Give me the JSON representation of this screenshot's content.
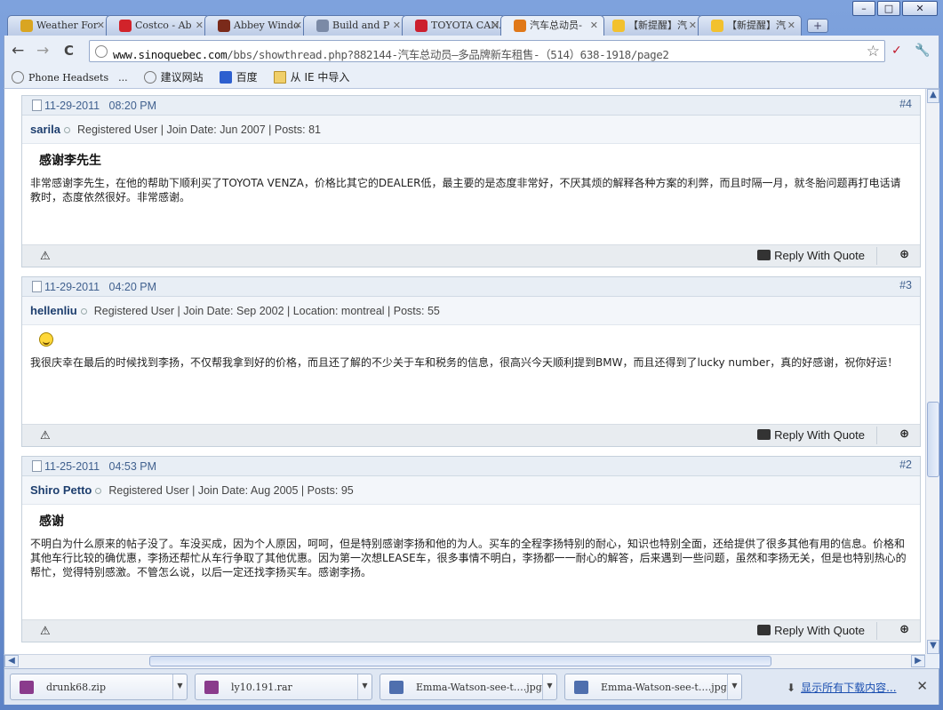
{
  "window": {
    "min": "–",
    "max": "□",
    "close": "✕"
  },
  "tabs": [
    {
      "label": "Weather For",
      "color": "#d9a521",
      "active": false
    },
    {
      "label": "Costco - Ab",
      "color": "#d1232a",
      "active": false
    },
    {
      "label": "Abbey Windo",
      "color": "#7a2a1a",
      "active": false
    },
    {
      "label": "Build and P",
      "color": "#7b8aa6",
      "active": false
    },
    {
      "label": "TOYOTA CANA",
      "color": "#cc1f2e",
      "active": false
    },
    {
      "label": "汽车总动员-",
      "color": "#e07818",
      "active": true
    },
    {
      "label": "【新提醒】汽",
      "color": "#f2c12e",
      "active": false
    },
    {
      "label": "【新提醒】汽",
      "color": "#f2c12e",
      "active": false
    }
  ],
  "toolbar": {
    "back": "←",
    "forward": "→",
    "reload": "C",
    "url_host": "www.sinoquebec.com",
    "url_path": "/bbs/showthread.php?882144-汽车总动员—多品牌新车租售-（514）638-1918/page2",
    "star": "☆",
    "wrench": "🔧"
  },
  "bookmarks": [
    {
      "label": "Phone Headsets　...",
      "mono": true
    },
    {
      "label": "建议网站",
      "mono": false
    },
    {
      "label": "百度",
      "mono": false
    },
    {
      "label": "从 IE 中导入",
      "mono": false
    }
  ],
  "posts": [
    {
      "date": "11-29-2011",
      "time": "08:20 PM",
      "number": "#4",
      "username": "sarila",
      "meta": "Registered User | Join Date: Jun 2007 | Posts: 81",
      "title": "感谢李先生",
      "body": "非常感谢李先生，在他的帮助下顺利买了TOYOTA VENZA，价格比其它的DEALER低，最主要的是态度非常好，不厌其烦的解释各种方案的利弊，而且时隔一月，就冬胎问题再打电话请教时，态度依然很好。非常感谢。"
    },
    {
      "date": "11-29-2011",
      "time": "04:20 PM",
      "number": "#3",
      "username": "hellenliu",
      "meta": "Registered User | Join Date: Sep 2002 | Location: montreal | Posts: 55",
      "title": "",
      "body": "我很庆幸在最后的时候找到李扬，不仅帮我拿到好的价格，而且还了解的不少关于车和税务的信息，很高兴今天顺利提到BMW，而且还得到了lucky number，真的好感谢，祝你好运！"
    },
    {
      "date": "11-25-2011",
      "time": "04:53 PM",
      "number": "#2",
      "username": "Shiro Petto",
      "meta": "Registered User | Join Date: Aug 2005 | Posts: 95",
      "title": "感谢",
      "body": "不明白为什么原来的帖子没了。车没买成，因为个人原因，呵呵，但是特别感谢李扬和他的为人。买车的全程李扬特别的耐心，知识也特别全面，还给提供了很多其他有用的信息。价格和其他车行比较的确优惠，李扬还帮忙从车行争取了其他优惠。因为第一次想LEASE车，很多事情不明白，李扬都一一耐心的解答，后来遇到一些问题，虽然和李扬无关，但是也特别热心的帮忙，觉得特别感激。不管怎么说，以后一定还找李扬买车。感谢李扬。"
    }
  ],
  "post_footer": {
    "warn": "⚠",
    "reply_quote": "Reply With Quote",
    "multiquote": "⊕"
  },
  "downloads": [
    {
      "name": "drunk68.zip",
      "color": "#8a3b8c"
    },
    {
      "name": "ly10.191.rar",
      "color": "#8a3b8c"
    },
    {
      "name": "Emma-Watson-see-t….jpg",
      "color": "#4f6fae"
    },
    {
      "name": "Emma-Watson-see-t….jpg",
      "color": "#4f6fae"
    }
  ],
  "show_all_downloads": "显示所有下载内容...",
  "shelf_close": "✕"
}
